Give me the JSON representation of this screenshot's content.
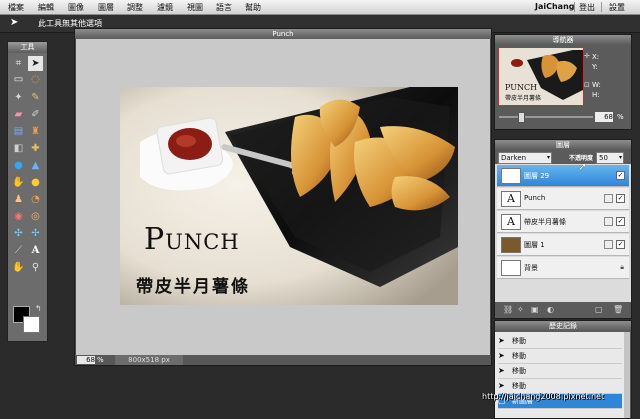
{
  "menubar": {
    "items": [
      "檔案",
      "編輯",
      "圖像",
      "圖層",
      "調整",
      "濾鏡",
      "視圖",
      "語言",
      "幫助"
    ],
    "user": "JaiChang",
    "logout": "登出",
    "settings": "設置"
  },
  "optionsbar": {
    "text": "此工具無其他選項"
  },
  "toolpanel": {
    "title": "工具"
  },
  "canvas": {
    "title": "Punch",
    "zoom": "68",
    "zoom_unit": "%",
    "size": "800x518 px",
    "photo_title": "Punch",
    "photo_subtitle": "帶皮半月薯條"
  },
  "navigator": {
    "title": "導航器",
    "x_label": "X:",
    "y_label": "Y:",
    "w_label": "W:",
    "h_label": "H:",
    "zoom": "68",
    "zoom_unit": "%",
    "zoom_level": 0.2
  },
  "layers": {
    "title": "圖層",
    "blend_mode": "Darken",
    "opacity_label": "不透明度",
    "opacity": "50",
    "items": [
      {
        "name": "圖層 29",
        "thumb": "",
        "selected": true
      },
      {
        "name": "Punch",
        "thumb": "A",
        "selected": false
      },
      {
        "name": "帶皮半月薯條",
        "thumb": "A",
        "selected": false
      },
      {
        "name": "圖層 1",
        "thumb": "",
        "selected": false
      },
      {
        "name": "背景",
        "thumb": "",
        "selected": false
      }
    ]
  },
  "history": {
    "title": "歷史記錄",
    "items": [
      "移動",
      "移動",
      "移動",
      "移動",
      "新圖層"
    ]
  },
  "watermark": "http://jaichang2008.pixnet.net",
  "colors": {
    "accent": "#2f86d6",
    "foreground": "#000000",
    "background": "#ffffff"
  }
}
